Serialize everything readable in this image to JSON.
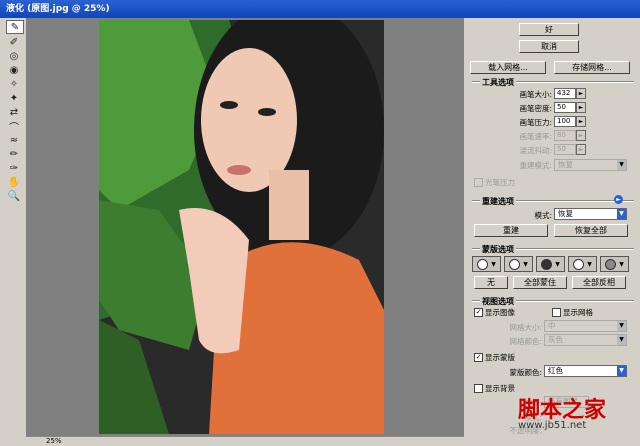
{
  "window": {
    "title": "液化 (原图.jpg @ 25%)"
  },
  "toolbar": {
    "icons": [
      "warp-icon",
      "reconstruct-icon",
      "twirl-cw-icon",
      "twirl-ccw-icon",
      "pucker-icon",
      "bloat-icon",
      "push-left-icon",
      "mirror-icon",
      "turbulence-icon",
      "freeze-mask-icon",
      "thaw-mask-icon",
      "hand-icon",
      "zoom-icon"
    ]
  },
  "buttons": {
    "ok": "好",
    "cancel": "取消",
    "load_mesh": "载入网格...",
    "save_mesh": "存储网格..."
  },
  "tool_options": {
    "header": "工具选项",
    "brush_size_label": "画笔大小:",
    "brush_size": "432",
    "brush_density_label": "画笔密度:",
    "brush_density": "50",
    "brush_pressure_label": "画笔压力:",
    "brush_pressure": "100",
    "brush_rate_label": "画笔速率:",
    "brush_rate": "80",
    "turbulent_jitter_label": "湍流抖动:",
    "turbulent_jitter": "50",
    "reconstruct_mode_label": "重建模式:",
    "reconstruct_mode": "恢复",
    "stylus_pressure_label": "光笔压力"
  },
  "reconstruct_options": {
    "header": "重建选项",
    "mode_label": "模式:",
    "mode": "恢复",
    "reconstruct_btn": "重建",
    "restore_all_btn": "恢复全部"
  },
  "mask_options": {
    "header": "蒙版选项",
    "none_btn": "无",
    "mask_all_btn": "全部蒙住",
    "invert_all_btn": "全部反相"
  },
  "view_options": {
    "header": "视图选项",
    "show_image_label": "显示图像",
    "show_mesh_label": "显示网格",
    "mesh_size_label": "网格大小:",
    "mesh_size": "中",
    "mesh_color_label": "网格颜色:",
    "mesh_color": "灰色",
    "show_mask_label": "显示蒙版",
    "mask_color_label": "蒙版颜色:",
    "mask_color": "红色",
    "show_backdrop_label": "显示背景",
    "use_label": "使用:",
    "use_value": "所有图层",
    "mode_label": "模式:",
    "opacity_label": "不透明度:"
  },
  "status": {
    "zoom": "25%"
  },
  "watermark": {
    "line1": "脚本之家",
    "line2": "www.jb51.net"
  }
}
